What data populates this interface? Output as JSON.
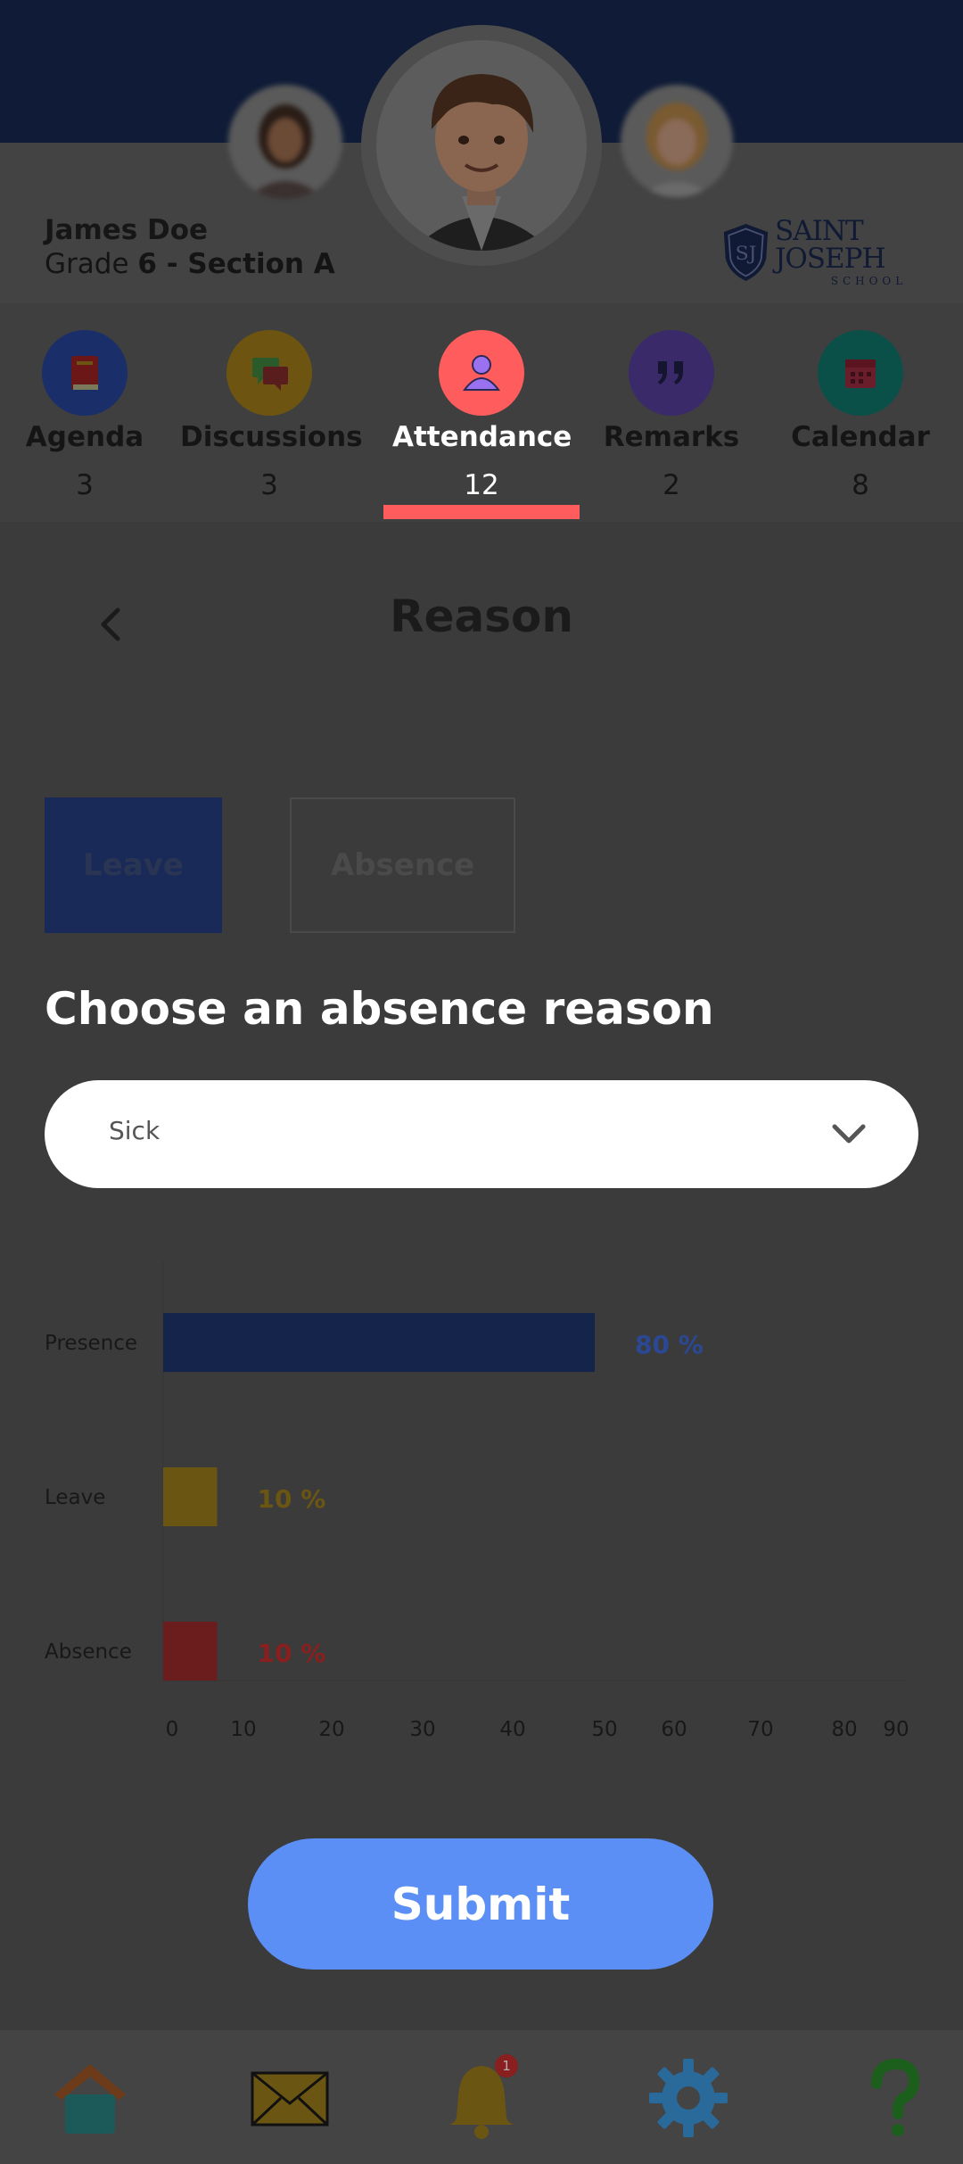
{
  "student": {
    "name": "James Doe",
    "grade_prefix": "Grade ",
    "grade": "6",
    "section_prefix": " - Section ",
    "section": "A"
  },
  "school": {
    "name": "SAINT JOSEPH",
    "subtitle": "SCHOOL",
    "monogram": "SJ"
  },
  "tabs": [
    {
      "label": "Agenda",
      "count": "3",
      "icon": "book-icon",
      "color": "#1a2e6a"
    },
    {
      "label": "Discussions",
      "count": "3",
      "icon": "chat-bubbles-icon",
      "color": "#6d5410"
    },
    {
      "label": "Attendance",
      "count": "12",
      "icon": "person-icon",
      "color": "#ff5d5d",
      "active": true
    },
    {
      "label": "Remarks",
      "count": "2",
      "icon": "quote-icon",
      "color": "#3a2a6a"
    },
    {
      "label": "Calendar",
      "count": "8",
      "icon": "calendar-icon",
      "color": "#0b5048"
    }
  ],
  "page": {
    "title": "Reason",
    "back_icon": "chevron-left-icon"
  },
  "type_toggle": {
    "leave_label": "Leave",
    "absence_label": "Absence",
    "selected": "Leave"
  },
  "form": {
    "heading": "Choose an absence reason",
    "reason_value": "Sick"
  },
  "chart_data": {
    "type": "bar",
    "orientation": "horizontal",
    "categories": [
      "Presence",
      "Leave",
      "Absence"
    ],
    "values": [
      80,
      10,
      10
    ],
    "value_labels": [
      "80 %",
      "10 %",
      "10 %"
    ],
    "colors": [
      "#15244a",
      "#6b5512",
      "#6b1c1c"
    ],
    "label_colors": [
      "#2b4894",
      "#6b5512",
      "#8a1f1f"
    ],
    "x_ticks": [
      0,
      10,
      20,
      30,
      40,
      50,
      60,
      70,
      80,
      90
    ],
    "xlim": [
      0,
      90
    ]
  },
  "submit": {
    "label": "Submit"
  },
  "bottom_nav": [
    {
      "name": "home-icon",
      "color": "#6e3b1a"
    },
    {
      "name": "mail-icon",
      "color": "#6b5512"
    },
    {
      "name": "bell-icon",
      "color": "#6b5512",
      "badge": "1"
    },
    {
      "name": "settings-gear-icon",
      "color": "#2a6a9a"
    },
    {
      "name": "help-icon",
      "color": "#1c5e1c"
    }
  ],
  "colors": {
    "header": "#101c37",
    "accent": "#ff5d5d",
    "submit": "#5b8ff5"
  }
}
